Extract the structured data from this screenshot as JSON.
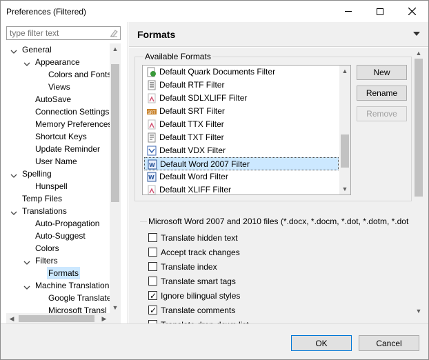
{
  "window": {
    "title": "Preferences (Filtered)"
  },
  "filter": {
    "placeholder": "type filter text"
  },
  "tree": [
    {
      "label": "General",
      "level": 0,
      "state": "expanded"
    },
    {
      "label": "Appearance",
      "level": 1,
      "state": "expanded"
    },
    {
      "label": "Colors and Fonts",
      "level": 2,
      "state": "leaf"
    },
    {
      "label": "Views",
      "level": 2,
      "state": "leaf"
    },
    {
      "label": "AutoSave",
      "level": 1,
      "state": "leaf"
    },
    {
      "label": "Connection Settings",
      "level": 1,
      "state": "leaf"
    },
    {
      "label": "Memory Preferences",
      "level": 1,
      "state": "leaf"
    },
    {
      "label": "Shortcut Keys",
      "level": 1,
      "state": "leaf"
    },
    {
      "label": "Update Reminder",
      "level": 1,
      "state": "leaf"
    },
    {
      "label": "User Name",
      "level": 1,
      "state": "leaf"
    },
    {
      "label": "Spelling",
      "level": 0,
      "state": "expanded"
    },
    {
      "label": "Hunspell",
      "level": 1,
      "state": "leaf"
    },
    {
      "label": "Temp Files",
      "level": 0,
      "state": "leaf"
    },
    {
      "label": "Translations",
      "level": 0,
      "state": "expanded"
    },
    {
      "label": "Auto-Propagation",
      "level": 1,
      "state": "leaf"
    },
    {
      "label": "Auto-Suggest",
      "level": 1,
      "state": "leaf"
    },
    {
      "label": "Colors",
      "level": 1,
      "state": "leaf"
    },
    {
      "label": "Filters",
      "level": 1,
      "state": "expanded"
    },
    {
      "label": "Formats",
      "level": 2,
      "state": "leaf",
      "selected": true
    },
    {
      "label": "Machine Translation",
      "level": 1,
      "state": "expanded"
    },
    {
      "label": "Google Translate",
      "level": 2,
      "state": "leaf"
    },
    {
      "label": "Microsoft Transl",
      "level": 2,
      "state": "leaf"
    }
  ],
  "page": {
    "title": "Formats"
  },
  "available": {
    "title": "Available Formats",
    "items": [
      {
        "label": "Default Quark Documents Filter",
        "icon": "quark-icon"
      },
      {
        "label": "Default RTF Filter",
        "icon": "rtf-icon"
      },
      {
        "label": "Default SDLXLIFF Filter",
        "icon": "sdlxliff-icon"
      },
      {
        "label": "Default SRT Filter",
        "icon": "srt-icon"
      },
      {
        "label": "Default TTX Filter",
        "icon": "ttx-icon"
      },
      {
        "label": "Default TXT Filter",
        "icon": "txt-icon"
      },
      {
        "label": "Default VDX Filter",
        "icon": "vdx-icon"
      },
      {
        "label": "Default Word 2007 Filter",
        "icon": "word-icon",
        "selected": true
      },
      {
        "label": "Default Word Filter",
        "icon": "word-icon"
      },
      {
        "label": "Default XLIFF Filter",
        "icon": "xliff-icon"
      }
    ],
    "buttons": {
      "new": "New",
      "rename": "Rename",
      "remove": "Remove"
    }
  },
  "word_group": {
    "title": "Microsoft Word 2007 and 2010 files (*.docx, *.docm, *.dot, *.dotm, *.dot",
    "options": [
      {
        "label": "Translate hidden text",
        "checked": false
      },
      {
        "label": "Accept track changes",
        "checked": false
      },
      {
        "label": "Translate index",
        "checked": false
      },
      {
        "label": "Translate smart tags",
        "checked": false
      },
      {
        "label": "Ignore bilingual styles",
        "checked": true
      },
      {
        "label": "Translate comments",
        "checked": true
      },
      {
        "label": "Translate drop-down list",
        "checked": false
      }
    ]
  },
  "footer": {
    "ok": "OK",
    "cancel": "Cancel"
  },
  "colors": {
    "selection": "#cce8ff",
    "panel": "#f0f0f0",
    "primary_border": "#0078d7"
  }
}
